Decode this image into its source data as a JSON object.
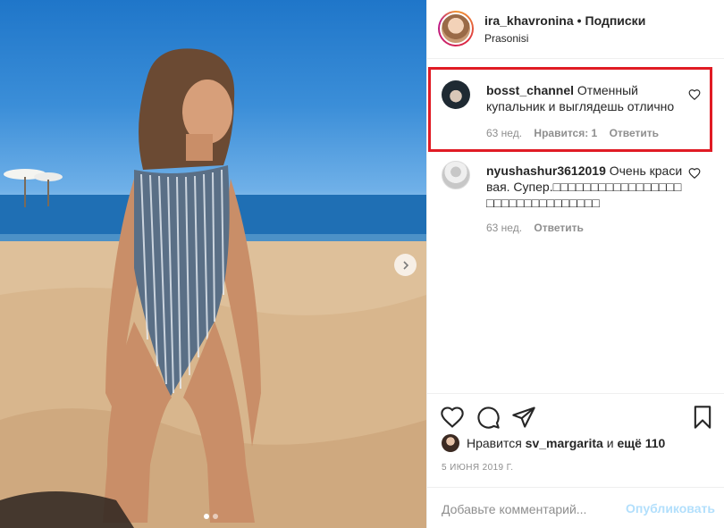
{
  "post_header": {
    "username": "ira_khavronina",
    "separator": "•",
    "follow_label": "Подписки",
    "location": "Prasonisi"
  },
  "comments": [
    {
      "username": "bosst_channel",
      "text": "Отменный купальник и выглядешь отлично",
      "age": "63 нед.",
      "likes": "Нравится: 1",
      "reply_label": "Ответить",
      "avatar_icon": "user-avatar-icon"
    },
    {
      "username": "nyushashur3612019",
      "text": "Очень красивая. Супер.□□□□□□□□□□□□□□□□□□□□□□□□□□□□□□□□",
      "age": "63 нед.",
      "reply_label": "Ответить",
      "avatar_icon": "default-avatar-icon"
    }
  ],
  "actions": {
    "like_icon": "heart-icon",
    "comment_icon": "comment-icon",
    "share_icon": "share-icon",
    "save_icon": "bookmark-icon"
  },
  "likes": {
    "prefix": "Нравится",
    "user": "sv_margarita",
    "middle": "и",
    "others": "ещё 110"
  },
  "date": "5 июня 2019 г.",
  "add_comment": {
    "placeholder": "Добавьте комментарий...",
    "publish_label": "Опубликовать"
  },
  "carousel": {
    "current_index": 1,
    "total": 2
  },
  "colors": {
    "highlight": "#e01b24",
    "publish_disabled": "#b2dffc",
    "muted": "#8e8e8e"
  }
}
